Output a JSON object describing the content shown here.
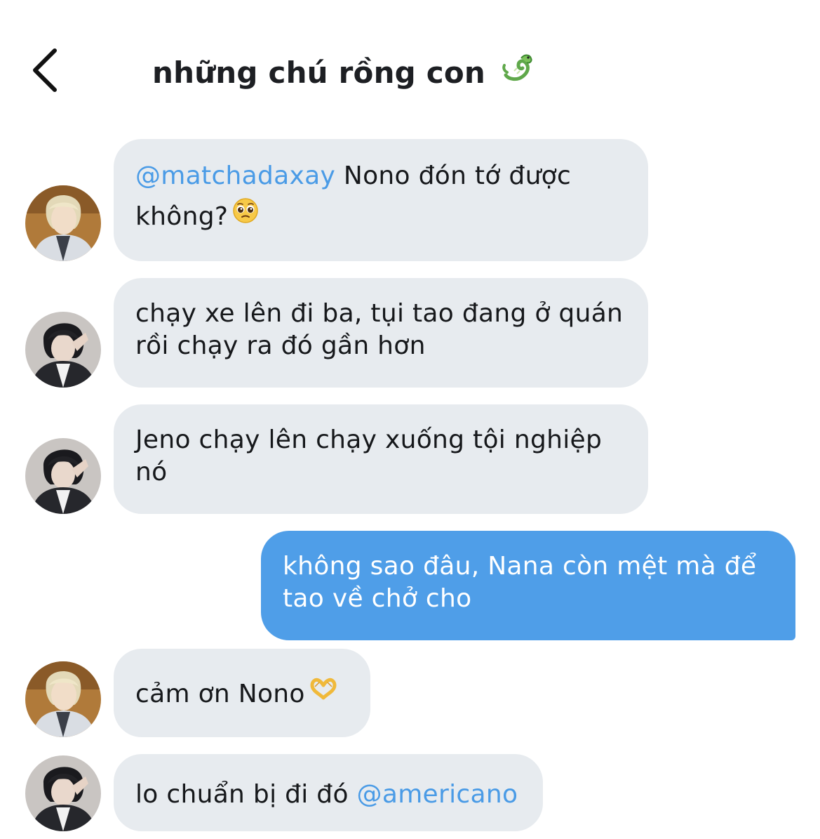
{
  "header": {
    "title": "những chú rồng con",
    "title_emoji": "dragon-emoji"
  },
  "messages": [
    {
      "sender": "other",
      "avatar": "avatar-blonde",
      "mention": "@matchadaxay",
      "line1": " Nono đón tớ được",
      "line2": "không?",
      "emoji": "pleading-face-emoji"
    },
    {
      "sender": "other",
      "avatar": "avatar-dark-hair",
      "line1": "chạy xe lên đi ba, tụi tao đang ở quán",
      "line2": "rồi chạy ra đó gần hơn"
    },
    {
      "sender": "other",
      "avatar": "avatar-dark-hair",
      "line1": "Jeno chạy lên chạy xuống tội nghiệp",
      "line2": "nó"
    },
    {
      "sender": "me",
      "line1": "không sao đâu, Nana còn mệt mà để",
      "line2": "tao về chở cho"
    },
    {
      "sender": "other",
      "avatar": "avatar-blonde",
      "line1": "cảm ơn Nono",
      "emoji": "heart-hands-emoji"
    },
    {
      "sender": "other",
      "avatar": "avatar-dark-hair",
      "line1": "lo chuẩn bị đi đó ",
      "mention": "@americano"
    }
  ],
  "colors": {
    "bubble_other": "#e7ebef",
    "bubble_me": "#4f9ee8",
    "mention": "#4a9be6",
    "text": "#16181b"
  }
}
